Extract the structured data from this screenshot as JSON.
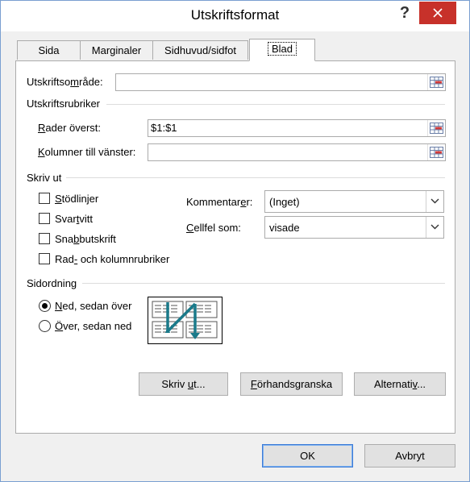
{
  "window": {
    "title": "Utskriftsformat",
    "help_label": "?"
  },
  "tabs": [
    {
      "label": "Sida"
    },
    {
      "label": "Marginaler"
    },
    {
      "label": "Sidhuvud/sidfot"
    },
    {
      "label": "Blad",
      "active": true
    }
  ],
  "print_area": {
    "label_pre": "Utskriftso",
    "label_u": "m",
    "label_post": "råde:",
    "value": ""
  },
  "print_titles": {
    "heading": "Utskriftsrubriker",
    "rows_label_u": "R",
    "rows_label_post": "ader överst:",
    "rows_value": "$1:$1",
    "cols_label_u": "K",
    "cols_label_post": "olumner till vänster:",
    "cols_value": ""
  },
  "print": {
    "heading": "Skriv ut",
    "gridlines": {
      "u": "S",
      "post": "tödlinjer",
      "checked": false
    },
    "bw": {
      "pre": "Svar",
      "u": "t",
      "post": "vitt",
      "checked": false
    },
    "draft": {
      "pre": "Sna",
      "u": "b",
      "post": "butskrift",
      "checked": false
    },
    "headings": {
      "pre": "Rad",
      "u": "-",
      "post": " och kolumnrubriker",
      "checked": false
    },
    "comments_label_pre": "Kommentar",
    "comments_label_u": "e",
    "comments_label_post": "r:",
    "comments_value": "(Inget)",
    "errors_label_u": "C",
    "errors_label_post": "ellfel som:",
    "errors_value": "visade"
  },
  "page_order": {
    "heading": "Sidordning",
    "down_then_over": {
      "u": "N",
      "post": "ed, sedan över",
      "checked": true
    },
    "over_then_down": {
      "u": "Ö",
      "post": "ver, sedan ned",
      "checked": false
    }
  },
  "panel_buttons": {
    "print": {
      "pre": "Skriv ",
      "u": "u",
      "post": "t..."
    },
    "preview": {
      "pre": "",
      "u": "F",
      "post": "örhandsgranska"
    },
    "options": {
      "pre": "Alternati",
      "u": "v",
      "post": "..."
    }
  },
  "footer": {
    "ok_label": "OK",
    "cancel_label": "Avbryt"
  },
  "colors": {
    "close_red": "#c7312a",
    "accent_blue": "#3d7bd6",
    "page_order_arrow": "#1a7a8a"
  }
}
